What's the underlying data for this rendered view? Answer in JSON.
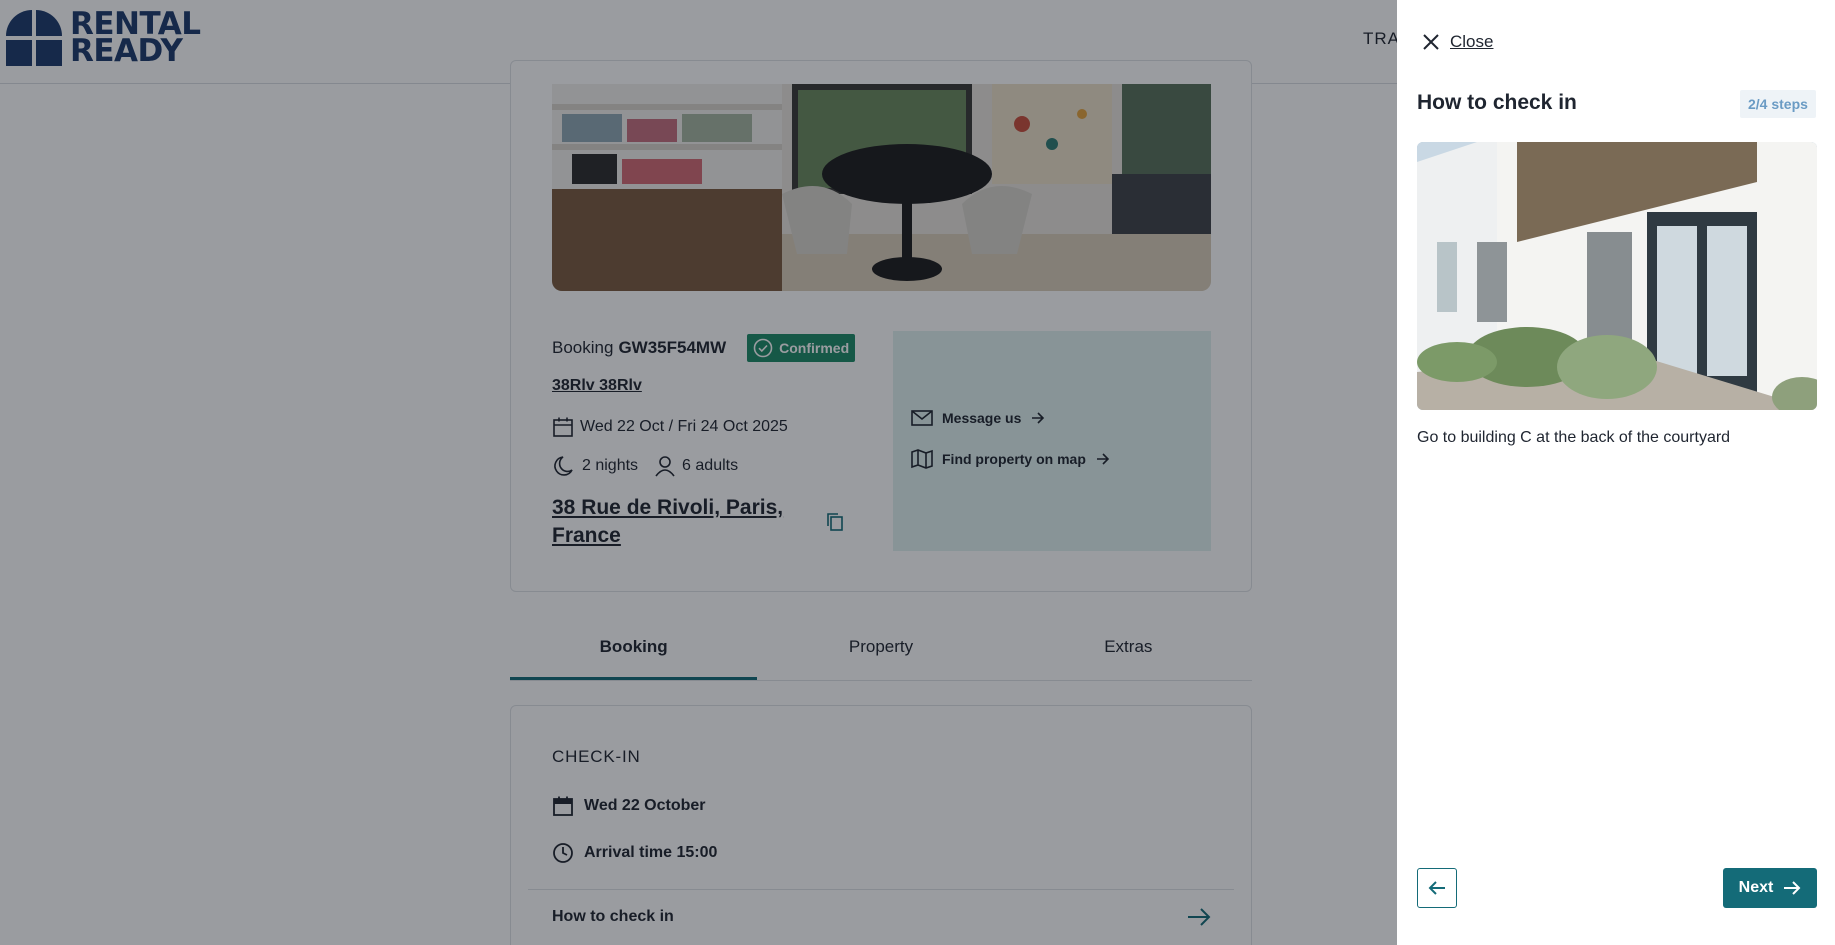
{
  "header": {
    "logo_line1": "RENTAL",
    "logo_line2": "READY",
    "nav_label": "TRA"
  },
  "booking": {
    "label": "Booking",
    "reference": "GW35F54MW",
    "status": "Confirmed",
    "guest_name": "38Rlv 38Rlv",
    "dates": "Wed 22 Oct / Fri 24 Oct 2025",
    "nights": "2 nights",
    "guests": "6 adults",
    "address": "38 Rue de Rivoli, Paris, France"
  },
  "contact": {
    "message_label": "Message us",
    "map_label": "Find property on map"
  },
  "tabs": [
    {
      "label": "Booking",
      "active": true
    },
    {
      "label": "Property",
      "active": false
    },
    {
      "label": "Extras",
      "active": false
    }
  ],
  "checkin": {
    "title": "CHECK-IN",
    "date": "Wed 22 October",
    "arrival": "Arrival time 15:00",
    "howto_label": "How to check in"
  },
  "panel": {
    "close_label": "Close",
    "title": "How to check in",
    "steps": "2/4 steps",
    "description": "Go to building C at the back of the courtyard",
    "next_label": "Next"
  },
  "colors": {
    "brand_navy": "#1d3a6b",
    "accent_teal": "#146b78",
    "confirmed_green": "#1c8a66",
    "contact_bg": "#e0f2ef"
  }
}
